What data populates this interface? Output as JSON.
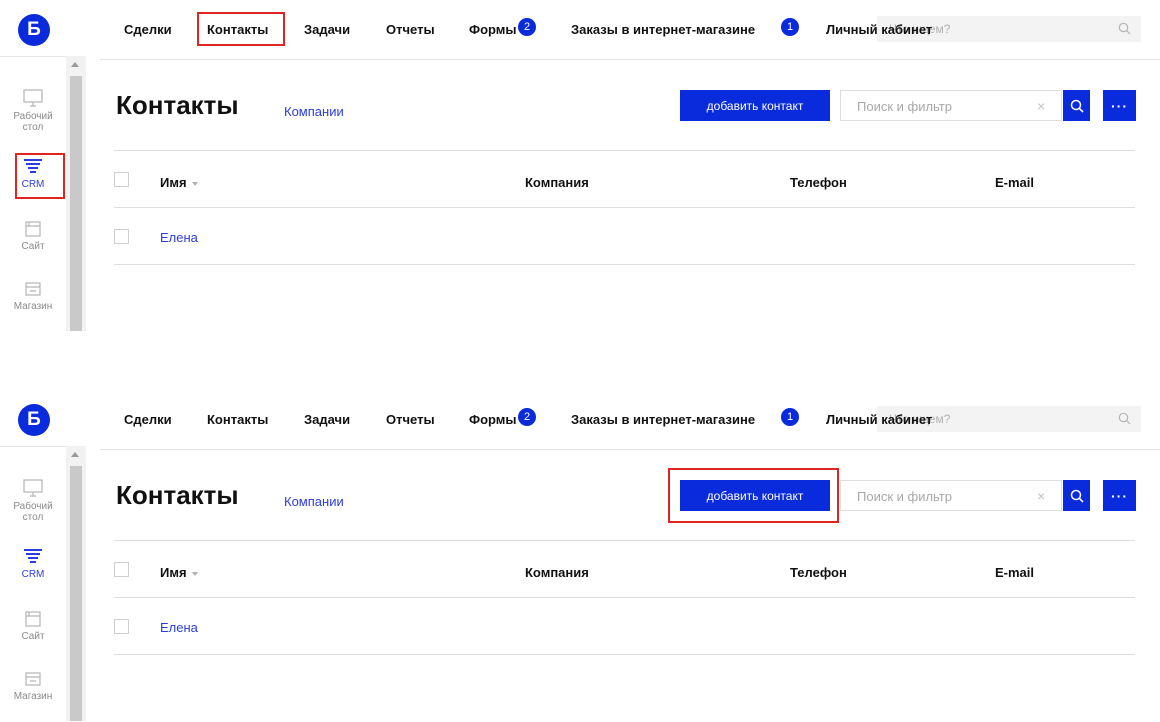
{
  "logo": {
    "letter": "Б"
  },
  "sidebar": {
    "items": [
      {
        "label": "Рабочий стол",
        "icon": "monitor-icon"
      },
      {
        "label": "CRM",
        "icon": "funnel-icon"
      },
      {
        "label": "Сайт",
        "icon": "site-icon"
      },
      {
        "label": "Магазин",
        "icon": "shop-icon"
      }
    ]
  },
  "topnav": {
    "items": [
      {
        "label": "Сделки"
      },
      {
        "label": "Контакты"
      },
      {
        "label": "Задачи"
      },
      {
        "label": "Отчеты"
      },
      {
        "label": "Формы",
        "badge": "2"
      },
      {
        "label": "Заказы в интернет-магазине",
        "badge": "1"
      },
      {
        "label": "Личный кабинет"
      }
    ],
    "search_placeholder": "Что ищем?"
  },
  "page": {
    "title": "Контакты",
    "companies_link": "Компании",
    "add_button": "добавить контакт",
    "filter_placeholder": "Поиск и фильтр",
    "filter_clear": "×",
    "more_button": "···"
  },
  "table": {
    "columns": [
      "Имя",
      "Компания",
      "Телефон",
      "E-mail"
    ],
    "rows": [
      {
        "name": "Елена",
        "company": "",
        "phone": "",
        "email": ""
      }
    ]
  },
  "colors": {
    "accent": "#0a2bdb",
    "link": "#2a3de0",
    "highlight": "#e02424"
  },
  "annotations": {
    "step1": [
      "Контакты",
      "CRM"
    ],
    "step2": [
      "добавить контакт"
    ]
  }
}
